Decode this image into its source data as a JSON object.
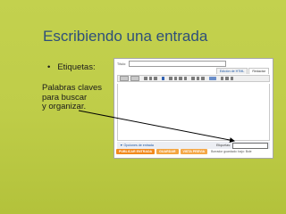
{
  "slide": {
    "title": "Escribiendo una entrada",
    "bullet": "Etiquetas:",
    "note_lines": [
      "Palabras claves",
      "para buscar",
      "y organizar."
    ]
  },
  "editor": {
    "title_label": "Título:",
    "tabs": [
      "Edición de HTML",
      "Redactar"
    ],
    "post_options": "▼ Opciones de entrada",
    "labels_label": "Etiquetas:",
    "buttons": {
      "publish": "PUBLICAR ENTRADA",
      "save": "GUARDAR",
      "preview": "VISTA PREVIA"
    },
    "saved_note": "Borrador guardado: bajo: Bole"
  },
  "colors": {
    "title": "#2e4f7a",
    "arrow": "#000000",
    "publish_button": "#f28a1d"
  }
}
